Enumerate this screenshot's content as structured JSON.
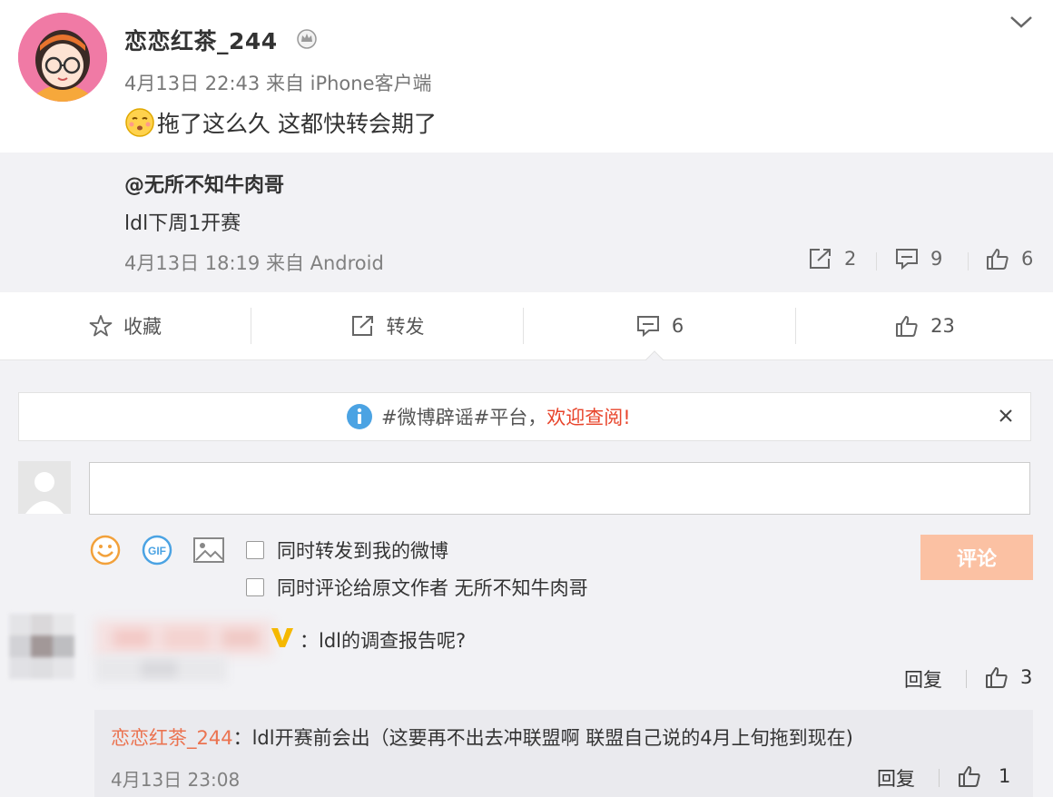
{
  "post": {
    "username": "恋恋红茶_244",
    "meta": "4月13日 22:43 来自 iPhone客户端",
    "text": "拖了这么久 这都快转会期了"
  },
  "repost": {
    "user": "@无所不知牛肉哥",
    "text": "ldl下周1开赛",
    "meta": "4月13日 18:19 来自 Android",
    "forward_count": "2",
    "comment_count": "9",
    "like_count": "6"
  },
  "actions": {
    "favorite_label": "收藏",
    "forward_label": "转发",
    "comment_count": "6",
    "like_count": "23"
  },
  "notice": {
    "text": "#微博辟谣#平台，",
    "highlight": "欢迎查阅!"
  },
  "composer": {
    "input_value": "",
    "option_repost": "同时转发到我的微博",
    "option_comment_author": "同时评论给原文作者 无所不知牛肉哥",
    "submit_label": "评论"
  },
  "comments": [
    {
      "text": "：ldl的调查报告呢?",
      "reply_label": "回复",
      "like_count": "3",
      "replies": [
        {
          "user": "恋恋红茶_244",
          "text": "：ldl开赛前会出（这要再不出去冲联盟啊 联盟自己说的4月上旬拖到现在)",
          "time": "4月13日 23:08",
          "reply_label": "回复",
          "like_count": "1"
        }
      ]
    }
  ],
  "colors": {
    "accent_orange": "#eb7350",
    "warn_red": "#e8452c",
    "submit_bg": "#fbc1a3",
    "badge_yellow": "#f5b800"
  }
}
